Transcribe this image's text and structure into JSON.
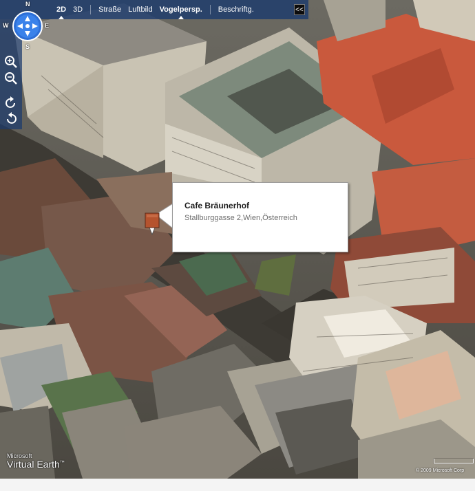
{
  "toolbar": {
    "modes": [
      {
        "label": "2D",
        "active": true
      },
      {
        "label": "3D",
        "active": false
      },
      {
        "label": "Straße",
        "active": false
      },
      {
        "label": "Luftbild",
        "active": false
      },
      {
        "label": "Vogelpersp.",
        "active": true
      }
    ],
    "labels_toggle": "Beschriftg.",
    "collapse_label": "<<"
  },
  "compass": {
    "north": "N",
    "east": "E",
    "south": "S",
    "west": "W"
  },
  "controls": {
    "zoom_in_icon": "zoom-in-icon",
    "zoom_out_icon": "zoom-out-icon",
    "rotate_cw_icon": "rotate-clockwise-icon",
    "rotate_ccw_icon": "rotate-counterclockwise-icon"
  },
  "popup": {
    "title": "Cafe Bräunerhof",
    "address": "Stallburggasse 2,Wien,Österreich"
  },
  "pushpin": {
    "color": "#b5532e",
    "icon": "pushpin-icon"
  },
  "branding": {
    "line1": "Microsoft",
    "line2": "Virtual Earth",
    "trademark": "™"
  },
  "copyright": "© 2009 Microsoft Corp",
  "colors": {
    "toolbar": "#1c3a6c",
    "compass_fill": "#2d6fd6"
  }
}
